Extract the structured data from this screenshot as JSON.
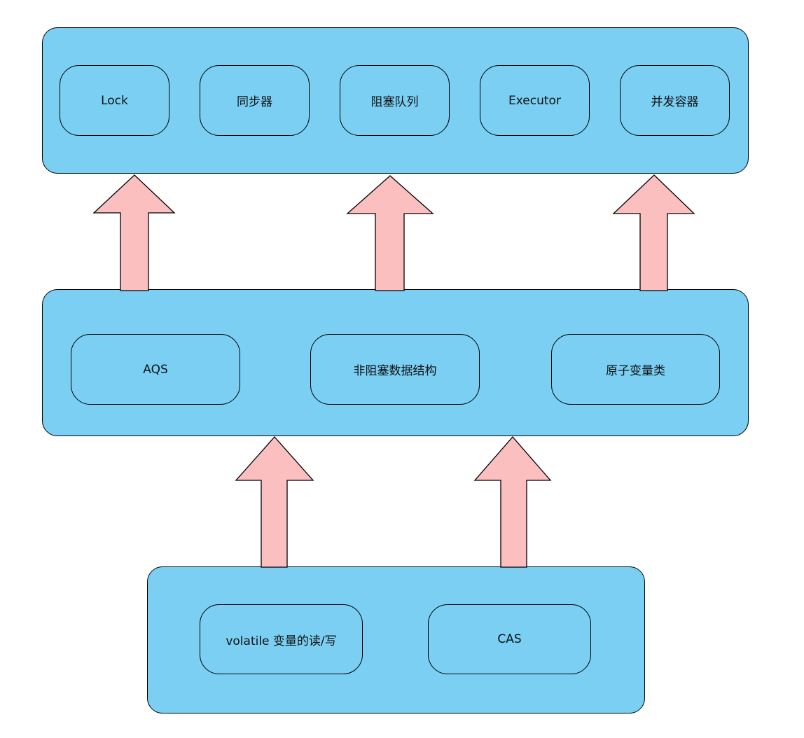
{
  "diagram": {
    "title": "",
    "colors": {
      "layer_fill": "#7acff3",
      "arrow_fill": "#fcbfbf",
      "stroke": "#000000"
    },
    "layers": [
      {
        "id": "top",
        "nodes": [
          {
            "label": "Lock"
          },
          {
            "label": "同步器"
          },
          {
            "label": "阻塞队列"
          },
          {
            "label": "Executor"
          },
          {
            "label": "并发容器"
          }
        ]
      },
      {
        "id": "middle",
        "nodes": [
          {
            "label": "AQS"
          },
          {
            "label": "非阻塞数据结构"
          },
          {
            "label": "原子变量类"
          }
        ]
      },
      {
        "id": "bottom",
        "nodes": [
          {
            "label": "volatile 变量的读/写"
          },
          {
            "label": "CAS"
          }
        ]
      }
    ],
    "connections": [
      {
        "from": "middle",
        "to": "top",
        "direction": "up"
      },
      {
        "from": "middle",
        "to": "top",
        "direction": "up"
      },
      {
        "from": "middle",
        "to": "top",
        "direction": "up"
      },
      {
        "from": "bottom",
        "to": "middle",
        "direction": "up"
      },
      {
        "from": "bottom",
        "to": "middle",
        "direction": "up"
      }
    ]
  }
}
